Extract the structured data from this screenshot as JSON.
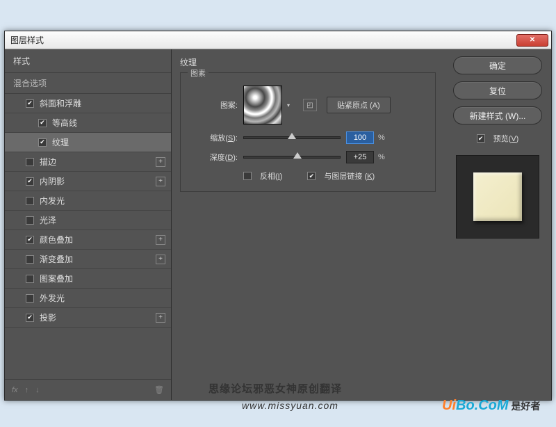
{
  "window": {
    "title": "图层样式"
  },
  "sidebar": {
    "header": "样式",
    "blendLabel": "混合选项",
    "items": [
      {
        "label": "斜面和浮雕",
        "checked": true,
        "hasPlus": false,
        "indent": 1
      },
      {
        "label": "等高线",
        "checked": true,
        "hasPlus": false,
        "indent": 2
      },
      {
        "label": "纹理",
        "checked": true,
        "hasPlus": false,
        "indent": 2,
        "selected": true
      },
      {
        "label": "描边",
        "checked": false,
        "hasPlus": true,
        "indent": 1
      },
      {
        "label": "内阴影",
        "checked": true,
        "hasPlus": true,
        "indent": 1
      },
      {
        "label": "内发光",
        "checked": false,
        "hasPlus": false,
        "indent": 1
      },
      {
        "label": "光泽",
        "checked": false,
        "hasPlus": false,
        "indent": 1
      },
      {
        "label": "颜色叠加",
        "checked": true,
        "hasPlus": true,
        "indent": 1
      },
      {
        "label": "渐变叠加",
        "checked": false,
        "hasPlus": true,
        "indent": 1
      },
      {
        "label": "图案叠加",
        "checked": false,
        "hasPlus": false,
        "indent": 1
      },
      {
        "label": "外发光",
        "checked": false,
        "hasPlus": false,
        "indent": 1
      },
      {
        "label": "投影",
        "checked": true,
        "hasPlus": true,
        "indent": 1
      }
    ],
    "footer": {
      "fx": "fx",
      "trash": "🗑"
    }
  },
  "main": {
    "panelTitle": "纹理",
    "groupLabel": "图素",
    "patternLabel": "图案:",
    "snapBtn": "贴紧原点 (A)",
    "scale": {
      "label": "缩放(S):",
      "value": "100",
      "unit": "%",
      "pos": 50
    },
    "depth": {
      "label": "深度(D):",
      "value": "+25",
      "unit": "%",
      "pos": 56
    },
    "invert": {
      "label": "反相(I)",
      "checked": false
    },
    "link": {
      "label": "与图层链接 (K)",
      "checked": true
    }
  },
  "right": {
    "okBtn": "确定",
    "resetBtn": "复位",
    "newStyleBtn": "新建样式 (W)...",
    "previewLabel": "预览(V)",
    "previewChecked": true
  },
  "watermarks": {
    "w1": "思缘论坛邪恶女神原创翻译",
    "w2": "www.missyuan.com",
    "w3a": "Ui",
    "w3b": "Bo.CoM",
    "w3c": "是好者"
  }
}
